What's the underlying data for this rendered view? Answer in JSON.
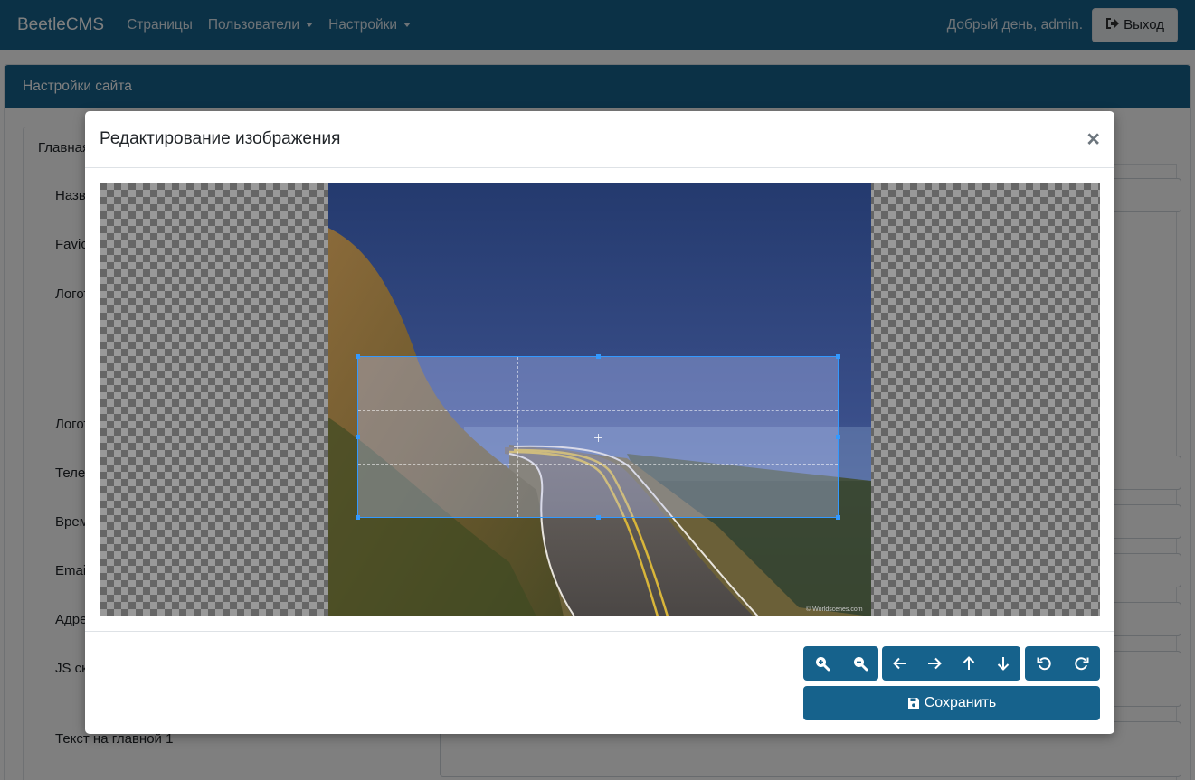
{
  "navbar": {
    "brand": "BeetleCMS",
    "items": [
      {
        "label": "Страницы",
        "dropdown": false
      },
      {
        "label": "Пользователи",
        "dropdown": true
      },
      {
        "label": "Настройки",
        "dropdown": true
      }
    ],
    "greeting": "Добрый день, admin.",
    "logout_label": "Выход",
    "logout_icon": "sign-out-icon"
  },
  "page": {
    "card_title": "Настройки сайта",
    "active_tab": "Главная",
    "form_labels": {
      "name": "Назван",
      "favicon": "Favicon",
      "logo1": "Логотип",
      "logo2": "Логотип",
      "phone": "Телефо",
      "time": "Время р",
      "email": "Email",
      "address": "Адрес",
      "js": "JS скри",
      "text_main": "Текст на главной 1"
    }
  },
  "modal": {
    "title": "Редактирование изображения",
    "close_symbol": "×",
    "toolbar": {
      "zoom": [
        "zoom-in-icon",
        "zoom-out-icon"
      ],
      "move": [
        "arrow-left-icon",
        "arrow-right-icon",
        "arrow-up-icon",
        "arrow-down-icon"
      ],
      "rotate": [
        "rotate-left-icon",
        "rotate-right-icon"
      ]
    },
    "save_label": "Сохранить",
    "save_icon": "floppy-disk-icon",
    "image_watermark": "© Worldscenes.com"
  },
  "colors": {
    "primary": "#16628c",
    "crop_border": "#3399ff",
    "backdrop": "rgba(0,0,0,0.5)"
  }
}
